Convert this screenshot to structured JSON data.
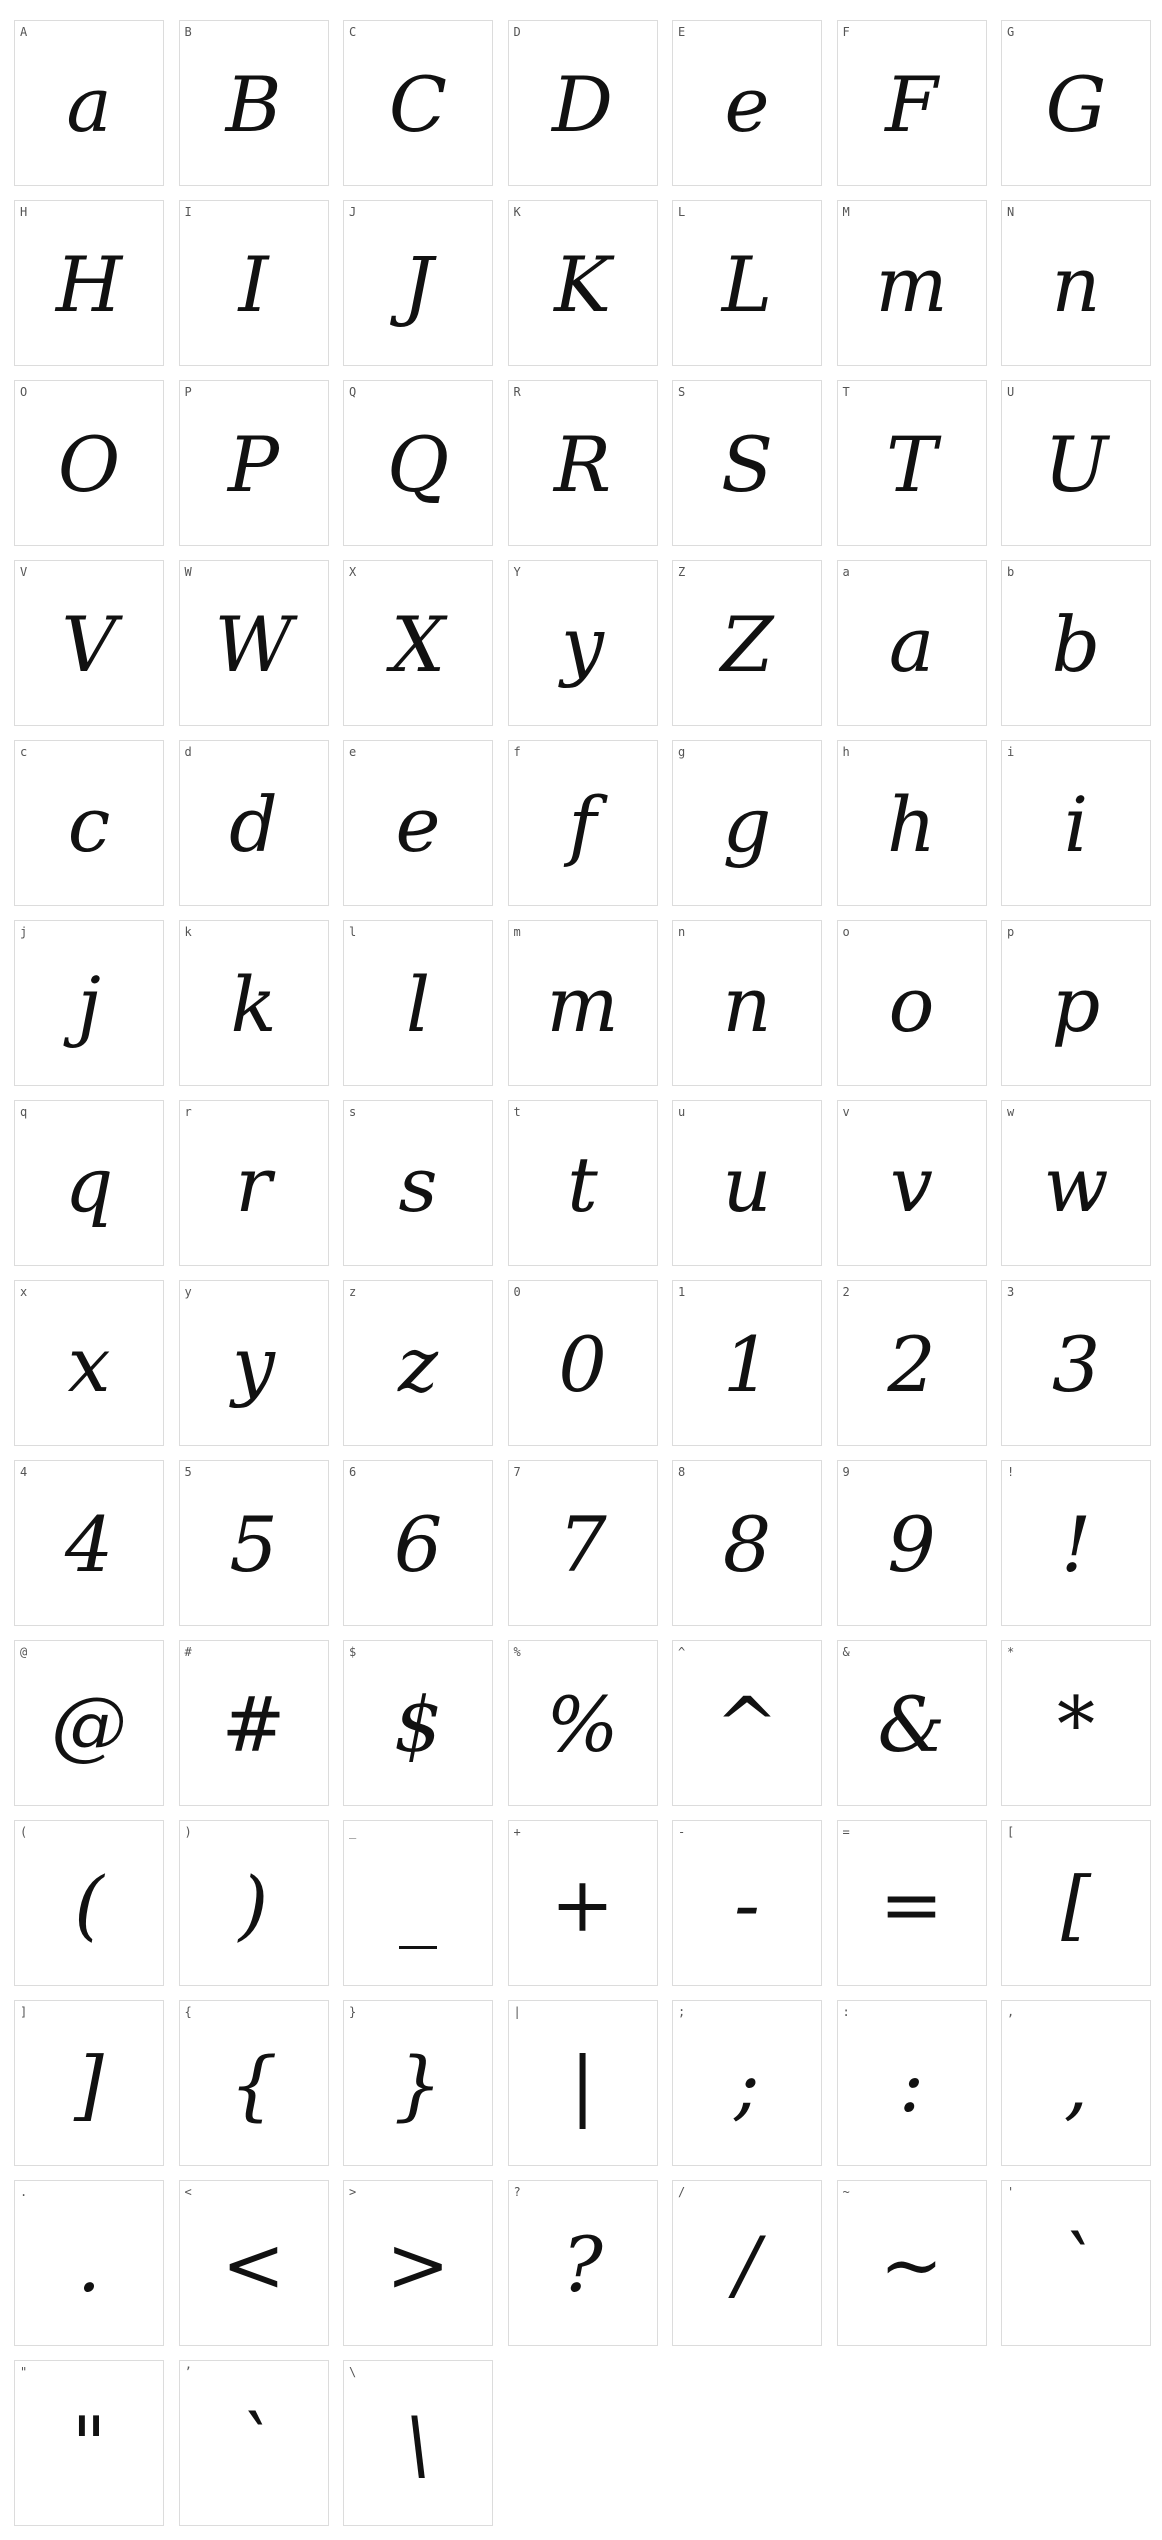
{
  "glyphs": [
    {
      "label": "A",
      "glyph": "a"
    },
    {
      "label": "B",
      "glyph": "B"
    },
    {
      "label": "C",
      "glyph": "C"
    },
    {
      "label": "D",
      "glyph": "D"
    },
    {
      "label": "E",
      "glyph": "e"
    },
    {
      "label": "F",
      "glyph": "F"
    },
    {
      "label": "G",
      "glyph": "G"
    },
    {
      "label": "H",
      "glyph": "H"
    },
    {
      "label": "I",
      "glyph": "I"
    },
    {
      "label": "J",
      "glyph": "J"
    },
    {
      "label": "K",
      "glyph": "K"
    },
    {
      "label": "L",
      "glyph": "L"
    },
    {
      "label": "M",
      "glyph": "m"
    },
    {
      "label": "N",
      "glyph": "n"
    },
    {
      "label": "O",
      "glyph": "O"
    },
    {
      "label": "P",
      "glyph": "P"
    },
    {
      "label": "Q",
      "glyph": "Q"
    },
    {
      "label": "R",
      "glyph": "R"
    },
    {
      "label": "S",
      "glyph": "S"
    },
    {
      "label": "T",
      "glyph": "T"
    },
    {
      "label": "U",
      "glyph": "U"
    },
    {
      "label": "V",
      "glyph": "V"
    },
    {
      "label": "W",
      "glyph": "W"
    },
    {
      "label": "X",
      "glyph": "X"
    },
    {
      "label": "Y",
      "glyph": "y"
    },
    {
      "label": "Z",
      "glyph": "Z"
    },
    {
      "label": "a",
      "glyph": "a"
    },
    {
      "label": "b",
      "glyph": "b"
    },
    {
      "label": "c",
      "glyph": "c"
    },
    {
      "label": "d",
      "glyph": "d"
    },
    {
      "label": "e",
      "glyph": "e"
    },
    {
      "label": "f",
      "glyph": "f"
    },
    {
      "label": "g",
      "glyph": "g"
    },
    {
      "label": "h",
      "glyph": "h"
    },
    {
      "label": "i",
      "glyph": "i"
    },
    {
      "label": "j",
      "glyph": "j"
    },
    {
      "label": "k",
      "glyph": "k"
    },
    {
      "label": "l",
      "glyph": "l"
    },
    {
      "label": "m",
      "glyph": "m"
    },
    {
      "label": "n",
      "glyph": "n"
    },
    {
      "label": "o",
      "glyph": "o"
    },
    {
      "label": "p",
      "glyph": "p"
    },
    {
      "label": "q",
      "glyph": "q"
    },
    {
      "label": "r",
      "glyph": "r"
    },
    {
      "label": "s",
      "glyph": "s"
    },
    {
      "label": "t",
      "glyph": "t"
    },
    {
      "label": "u",
      "glyph": "u"
    },
    {
      "label": "v",
      "glyph": "v"
    },
    {
      "label": "w",
      "glyph": "w"
    },
    {
      "label": "x",
      "glyph": "x"
    },
    {
      "label": "y",
      "glyph": "y"
    },
    {
      "label": "z",
      "glyph": "z"
    },
    {
      "label": "0",
      "glyph": "0"
    },
    {
      "label": "1",
      "glyph": "1"
    },
    {
      "label": "2",
      "glyph": "2"
    },
    {
      "label": "3",
      "glyph": "3"
    },
    {
      "label": "4",
      "glyph": "4"
    },
    {
      "label": "5",
      "glyph": "5"
    },
    {
      "label": "6",
      "glyph": "6"
    },
    {
      "label": "7",
      "glyph": "7"
    },
    {
      "label": "8",
      "glyph": "8"
    },
    {
      "label": "9",
      "glyph": "9"
    },
    {
      "label": "!",
      "glyph": "!"
    },
    {
      "label": "@",
      "glyph": "@"
    },
    {
      "label": "#",
      "glyph": "#"
    },
    {
      "label": "$",
      "glyph": "$"
    },
    {
      "label": "%",
      "glyph": "%"
    },
    {
      "label": "^",
      "glyph": "^"
    },
    {
      "label": "&",
      "glyph": "&"
    },
    {
      "label": "*",
      "glyph": "*"
    },
    {
      "label": "(",
      "glyph": "("
    },
    {
      "label": ")",
      "glyph": ")"
    },
    {
      "label": "_",
      "glyph": "_"
    },
    {
      "label": "+",
      "glyph": "+"
    },
    {
      "label": "-",
      "glyph": "-"
    },
    {
      "label": "=",
      "glyph": "="
    },
    {
      "label": "[",
      "glyph": "["
    },
    {
      "label": "]",
      "glyph": "]"
    },
    {
      "label": "{",
      "glyph": "{"
    },
    {
      "label": "}",
      "glyph": "}"
    },
    {
      "label": "|",
      "glyph": "|"
    },
    {
      "label": ";",
      "glyph": ";"
    },
    {
      "label": ":",
      "glyph": ":"
    },
    {
      "label": ",",
      "glyph": ","
    },
    {
      "label": ".",
      "glyph": "."
    },
    {
      "label": "<",
      "glyph": "<"
    },
    {
      "label": ">",
      "glyph": ">"
    },
    {
      "label": "?",
      "glyph": "?"
    },
    {
      "label": "/",
      "glyph": "/"
    },
    {
      "label": "~",
      "glyph": "~"
    },
    {
      "label": "'",
      "glyph": "`"
    },
    {
      "label": "\"",
      "glyph": "\""
    },
    {
      "label": "’",
      "glyph": "`"
    },
    {
      "label": "\\",
      "glyph": "\\"
    }
  ]
}
